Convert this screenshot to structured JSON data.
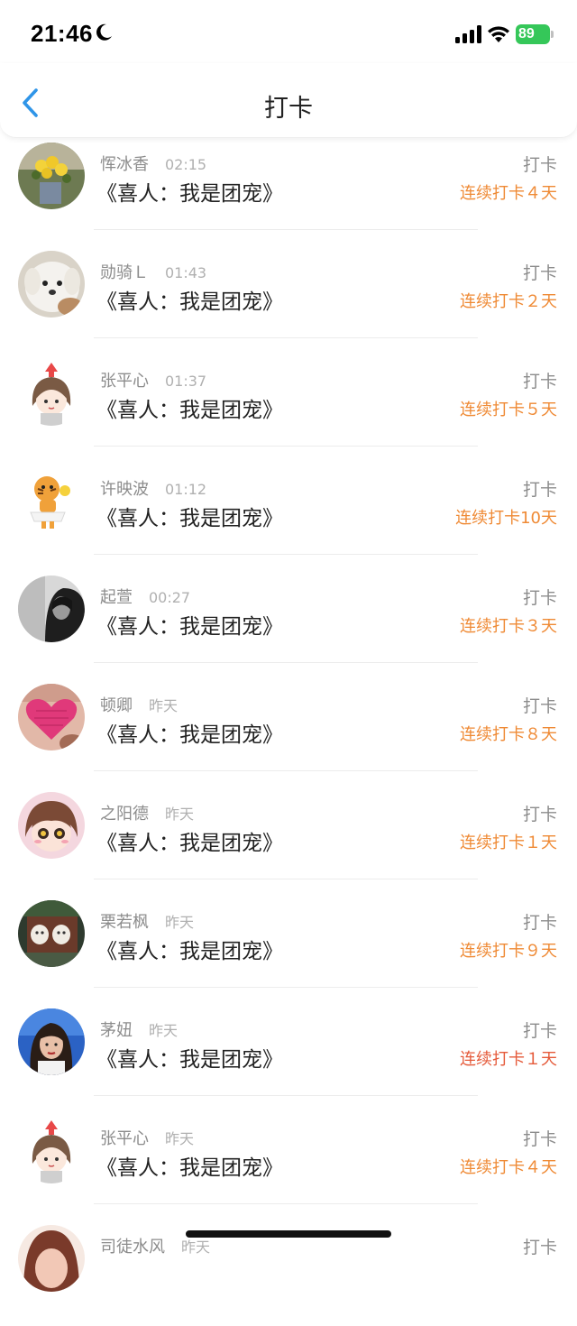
{
  "status_bar": {
    "time": "21:46",
    "battery": "89"
  },
  "nav": {
    "title": "打卡",
    "back_icon": "chevron-left-icon"
  },
  "colors": {
    "accent_blue": "#2f95e8",
    "streak_orange": "#ef8a35",
    "streak_red": "#e55a3a",
    "battery_green": "#35c759"
  },
  "entries": [
    {
      "name": "恽冰香",
      "time": "02:15",
      "book": "《喜人：我是团宠》",
      "action": "打卡",
      "streak": "连续打卡４天"
    },
    {
      "name": "勋骑Ｌ",
      "time": "01:43",
      "book": "《喜人：我是团宠》",
      "action": "打卡",
      "streak": "连续打卡２天"
    },
    {
      "name": "张平心",
      "time": "01:37",
      "book": "《喜人：我是团宠》",
      "action": "打卡",
      "streak": "连续打卡５天"
    },
    {
      "name": "许映波",
      "time": "01:12",
      "book": "《喜人：我是团宠》",
      "action": "打卡",
      "streak": "连续打卡10天"
    },
    {
      "name": "起萱",
      "time": "00:27",
      "book": "《喜人：我是团宠》",
      "action": "打卡",
      "streak": "连续打卡３天"
    },
    {
      "name": "顿卿",
      "time": "昨天",
      "book": "《喜人：我是团宠》",
      "action": "打卡",
      "streak": "连续打卡８天"
    },
    {
      "name": "之阳德",
      "time": "昨天",
      "book": "《喜人：我是团宠》",
      "action": "打卡",
      "streak": "连续打卡１天"
    },
    {
      "name": "栗若枫",
      "time": "昨天",
      "book": "《喜人：我是团宠》",
      "action": "打卡",
      "streak": "连续打卡９天"
    },
    {
      "name": "茅妞",
      "time": "昨天",
      "book": "《喜人：我是团宠》",
      "action": "打卡",
      "streak": "连续打卡１天"
    },
    {
      "name": "张平心",
      "time": "昨天",
      "book": "《喜人：我是团宠》",
      "action": "打卡",
      "streak": "连续打卡４天"
    },
    {
      "name": "司徒水风",
      "time": "昨天",
      "book": "",
      "action": "打卡",
      "streak": ""
    }
  ]
}
